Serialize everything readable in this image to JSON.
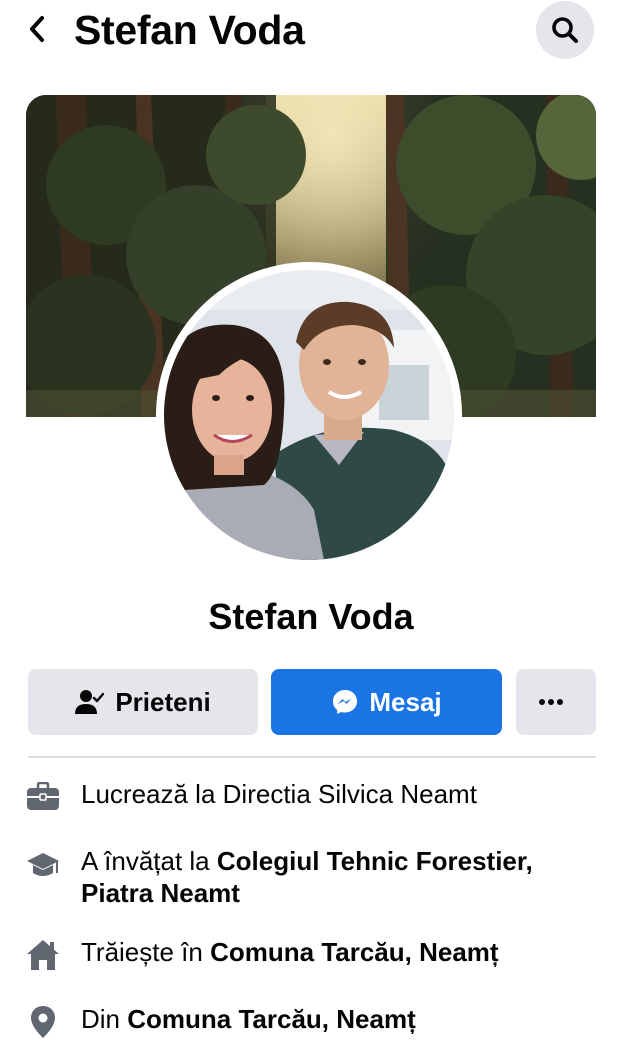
{
  "header": {
    "title": "Stefan Voda"
  },
  "profile": {
    "name": "Stefan Voda"
  },
  "actions": {
    "friends_label": "Prieteni",
    "message_label": "Mesaj"
  },
  "details": {
    "work": {
      "prefix": "Lucrează la Directia Silvica Neamt"
    },
    "education": {
      "prefix": "A învățat la ",
      "bold": "Colegiul Tehnic Forestier, Piatra Neamt"
    },
    "lives": {
      "prefix": "Trăiește în ",
      "bold": "Comuna Tarcău, Neamț"
    },
    "from": {
      "prefix": "Din ",
      "bold": "Comuna Tarcău, Neamț"
    }
  },
  "icons": {
    "back": "chevron-left-icon",
    "search": "search-icon",
    "friends": "person-check-icon",
    "message": "messenger-icon",
    "more": "more-dots-icon",
    "work": "briefcase-icon",
    "education": "graduation-cap-icon",
    "home": "house-icon",
    "location": "location-pin-icon"
  },
  "colors": {
    "accent": "#1b74e4",
    "button_gray": "#e4e6eb",
    "icon_gray": "#606770",
    "text": "#050505"
  }
}
